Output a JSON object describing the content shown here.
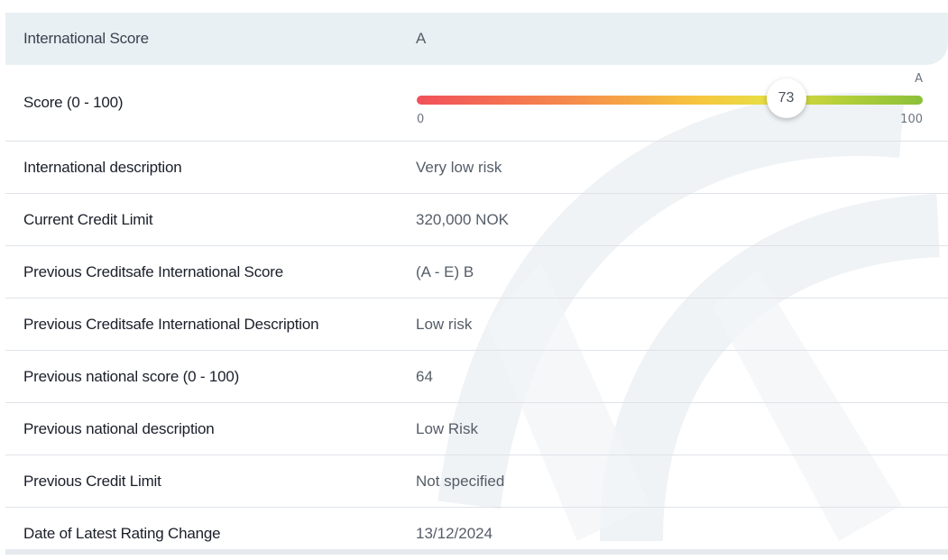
{
  "header": {
    "label": "International Score",
    "value": "A"
  },
  "score": {
    "label": "Score (0 - 100)",
    "value": 73,
    "value_text": "73",
    "min_text": "0",
    "max_text": "100",
    "grade": "A"
  },
  "rows": [
    {
      "label": "International description",
      "value": "Very low risk"
    },
    {
      "label": "Current Credit Limit",
      "value": "320,000 NOK"
    },
    {
      "label": "Previous Creditsafe International Score",
      "value": "(A - E) B"
    },
    {
      "label": "Previous Creditsafe International Description",
      "value": "Low risk"
    },
    {
      "label": "Previous national score (0 - 100)",
      "value": "64"
    },
    {
      "label": "Previous national description",
      "value": "Low Risk"
    },
    {
      "label": "Previous Credit Limit",
      "value": "Not specified"
    },
    {
      "label": "Date of Latest Rating Change",
      "value": "13/12/2024"
    }
  ],
  "colors": {
    "header_bg": "#e9f0f3",
    "gauge_low": "#f1505a",
    "gauge_mid": "#f7c43f",
    "gauge_high": "#8bc03a"
  }
}
